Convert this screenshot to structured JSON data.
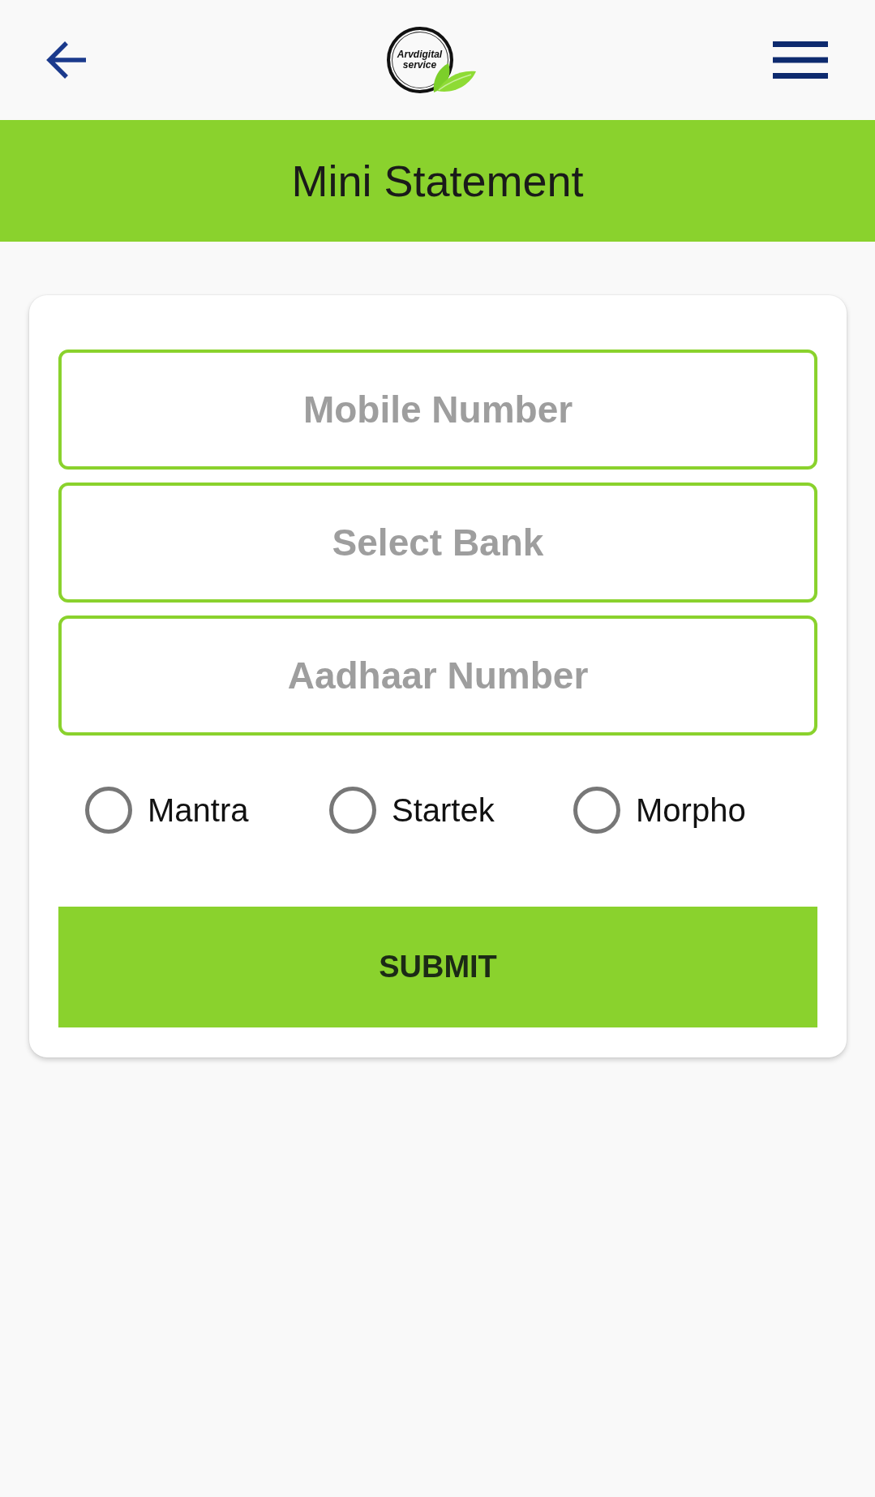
{
  "logo": {
    "lines": [
      "Arvdigital",
      "service"
    ]
  },
  "page_title": "Mini Statement",
  "fields": [
    {
      "placeholder": "Mobile Number"
    },
    {
      "placeholder": "Select Bank"
    },
    {
      "placeholder": "Aadhaar Number"
    }
  ],
  "devices": [
    {
      "label": "Mantra",
      "selected": false
    },
    {
      "label": "Startek",
      "selected": false
    },
    {
      "label": "Morpho",
      "selected": false
    }
  ],
  "submit_button": {
    "label": "SUBMIT"
  }
}
